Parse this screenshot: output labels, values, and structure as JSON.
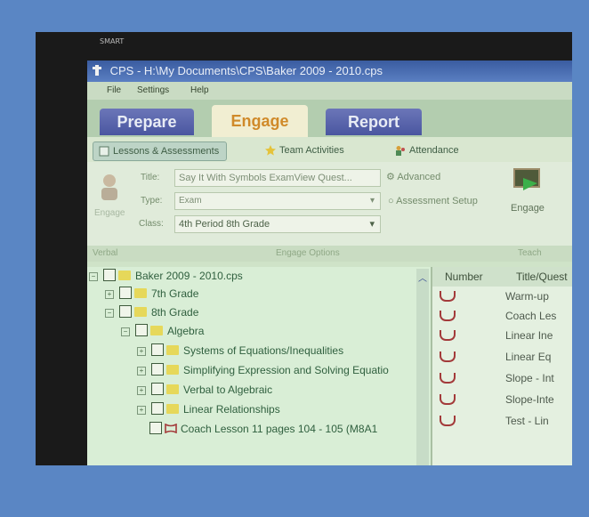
{
  "monitor": {
    "brand": "SMART"
  },
  "window": {
    "title": "CPS - H:\\My Documents\\CPS\\Baker 2009 - 2010.cps"
  },
  "menu": {
    "items": [
      "File",
      "Settings",
      "Help"
    ]
  },
  "main_tabs": [
    {
      "label": "Prepare",
      "active": false
    },
    {
      "label": "Engage",
      "active": true
    },
    {
      "label": "Report",
      "active": false
    }
  ],
  "sub_tabs": [
    {
      "label": "Lessons & Assessments",
      "active": true
    },
    {
      "label": "Team Activities",
      "active": false
    },
    {
      "label": "Attendance",
      "active": false
    }
  ],
  "ribbon": {
    "verbal_button": "Engage",
    "title_label": "Title:",
    "title_value": "Say It With Symbols ExamView Quest...",
    "type_label": "Type:",
    "type_value": "Exam",
    "class_label": "Class:",
    "class_value": "4th Period 8th Grade",
    "advanced": "Advanced",
    "assessment_setup": "Assessment Setup",
    "engage_button": "Engage",
    "group_verbal": "Verbal",
    "group_options": "Engage Options",
    "group_teach": "Teach"
  },
  "tree": [
    {
      "label": "Baker 2009 - 2010.cps",
      "level": 0,
      "expander": "−"
    },
    {
      "label": "7th Grade",
      "level": 1,
      "expander": "+"
    },
    {
      "label": "8th Grade",
      "level": 1,
      "expander": "−"
    },
    {
      "label": "Algebra",
      "level": 2,
      "expander": "−"
    },
    {
      "label": "Systems of Equations/Inequalities",
      "level": 3,
      "expander": "+"
    },
    {
      "label": "Simplifying Expression and Solving Equatio",
      "level": 3,
      "expander": "+"
    },
    {
      "label": "Verbal to Algebraic",
      "level": 3,
      "expander": "+"
    },
    {
      "label": "Linear Relationships",
      "level": 3,
      "expander": "+"
    },
    {
      "label": "Coach Lesson 11 pages 104 - 105  (M8A1",
      "level": 3,
      "expander": ""
    }
  ],
  "list": {
    "col_number": "Number",
    "col_title": "Title/Quest",
    "rows": [
      "Warm-up",
      "Coach Les",
      "Linear Ine",
      "Linear Eq",
      "Slope - Int",
      "Slope-Inte",
      "Test - Lin"
    ]
  },
  "colors": {
    "outer_background": "#5a86c4",
    "engage_tab_text": "#d08a2a"
  }
}
